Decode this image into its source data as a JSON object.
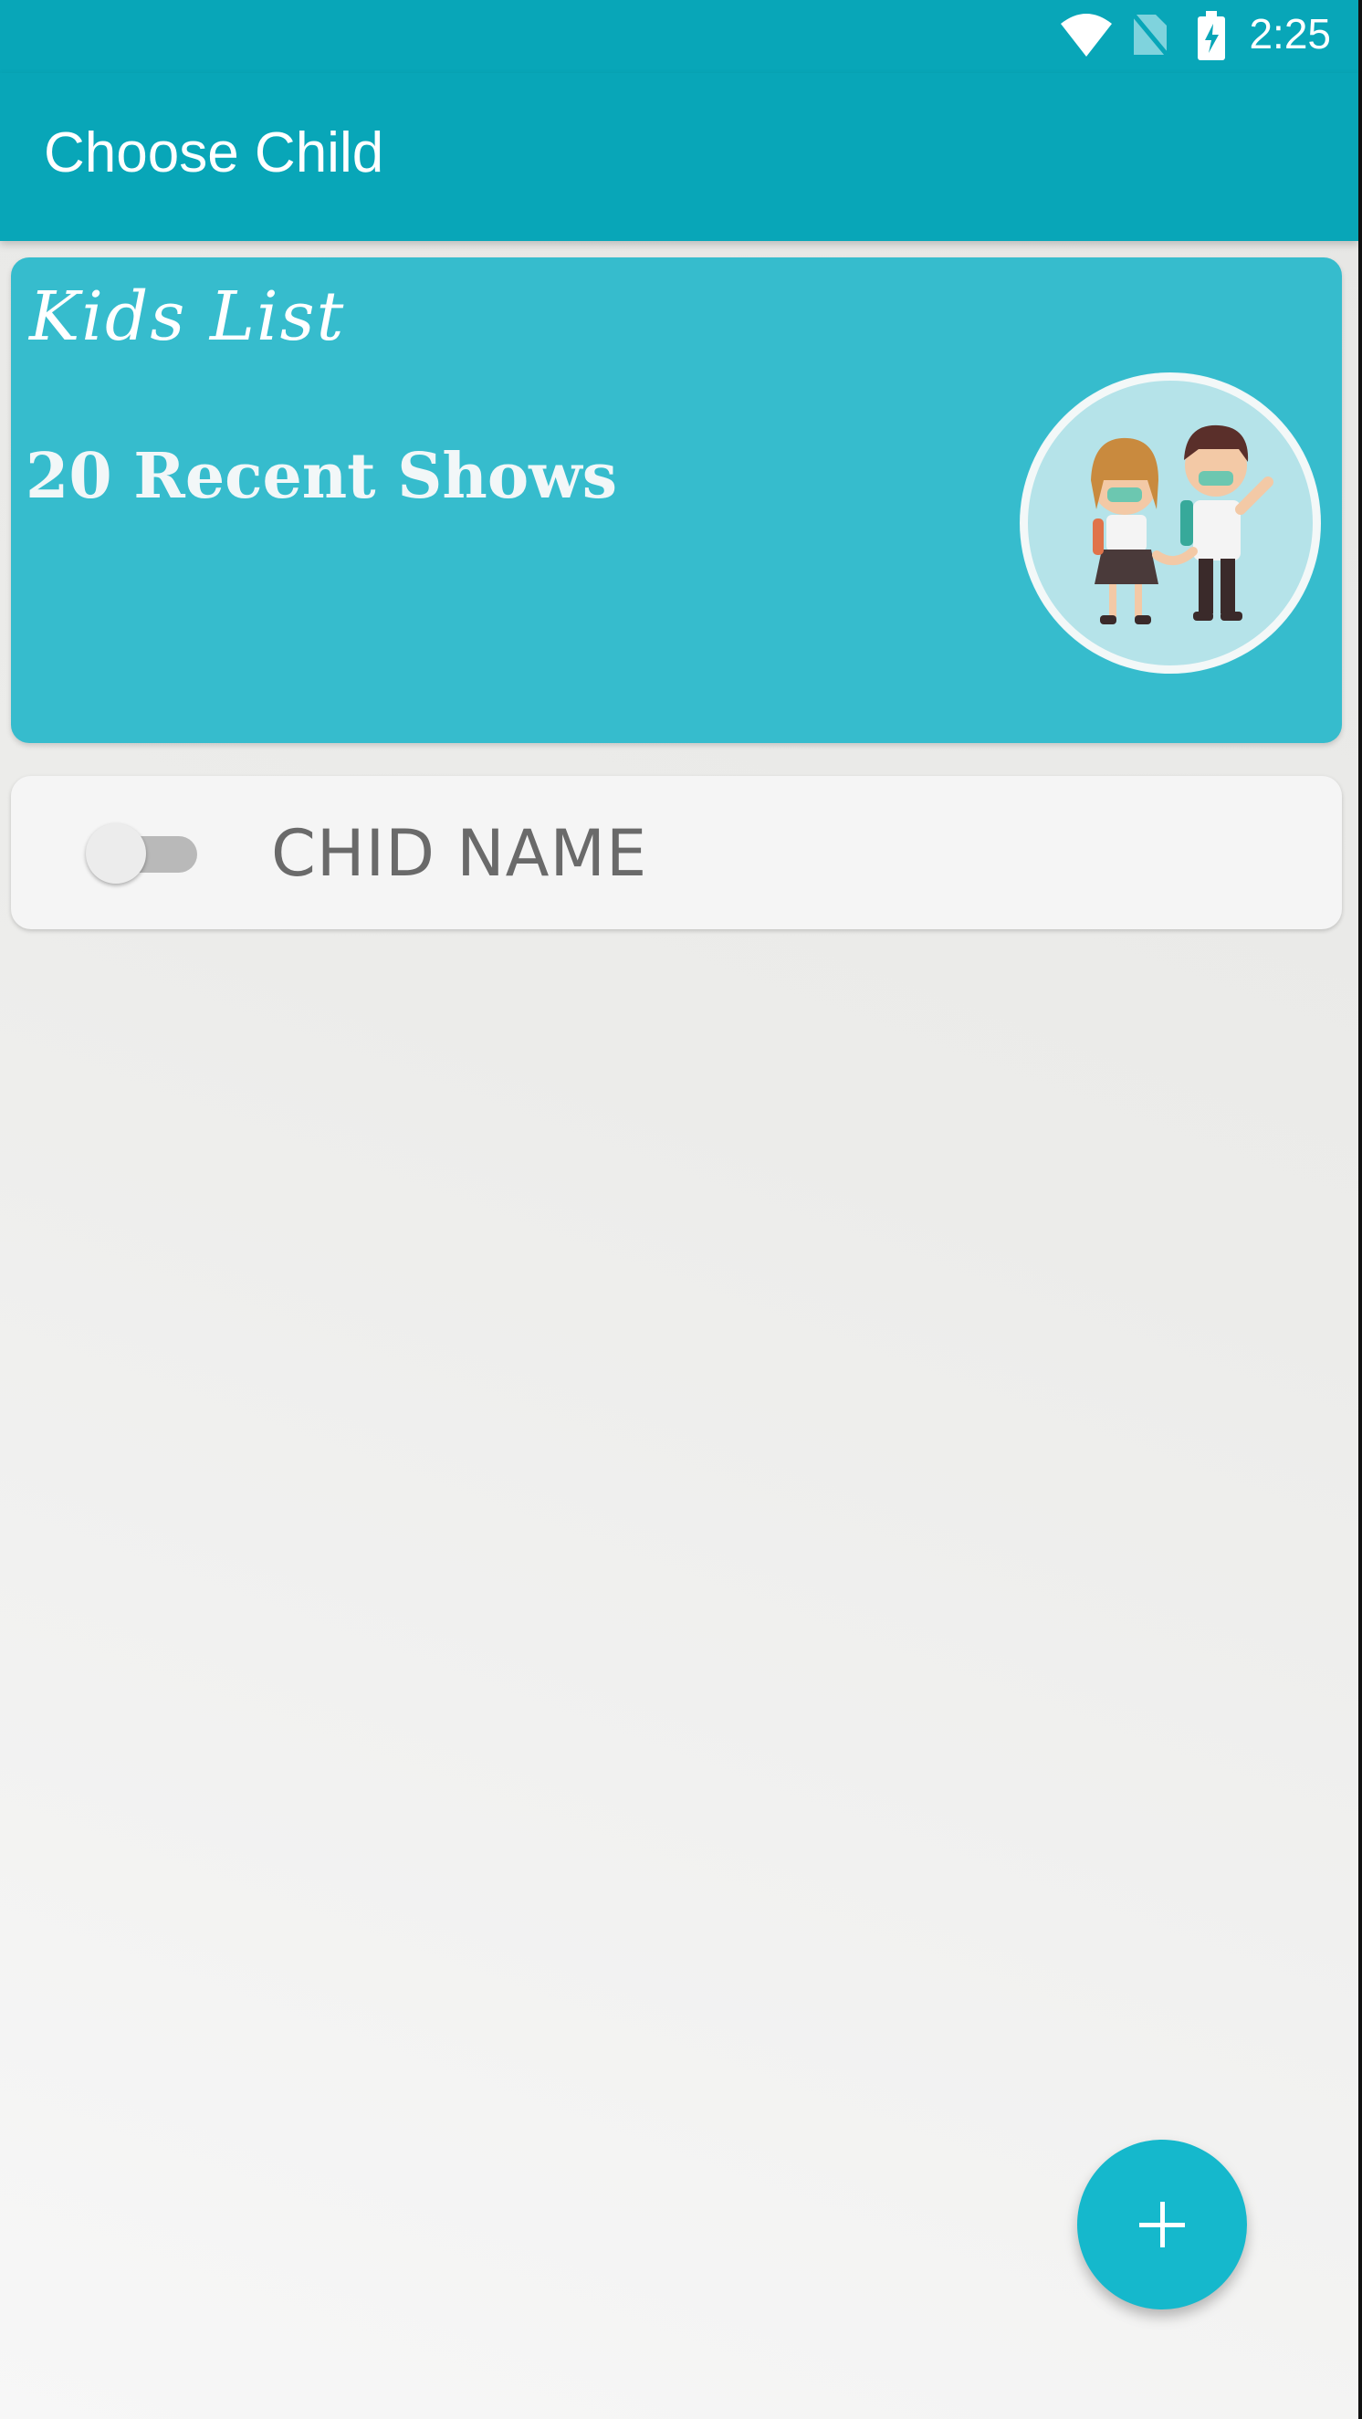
{
  "status_bar": {
    "time": "2:25",
    "icons": [
      "wifi-icon",
      "no-sim-icon",
      "battery-charging-icon"
    ]
  },
  "app_bar": {
    "title": "Choose Child"
  },
  "header_card": {
    "title": "Kids List",
    "subtitle": "20 Recent Shows",
    "image": "kids-illustration"
  },
  "child_list": [
    {
      "name": "CHID NAME",
      "toggle_on": false
    }
  ],
  "fab": {
    "icon": "plus-icon"
  },
  "colors": {
    "primary": "#08a6b8",
    "card": "#36bccd",
    "fab": "#15b8cc"
  }
}
